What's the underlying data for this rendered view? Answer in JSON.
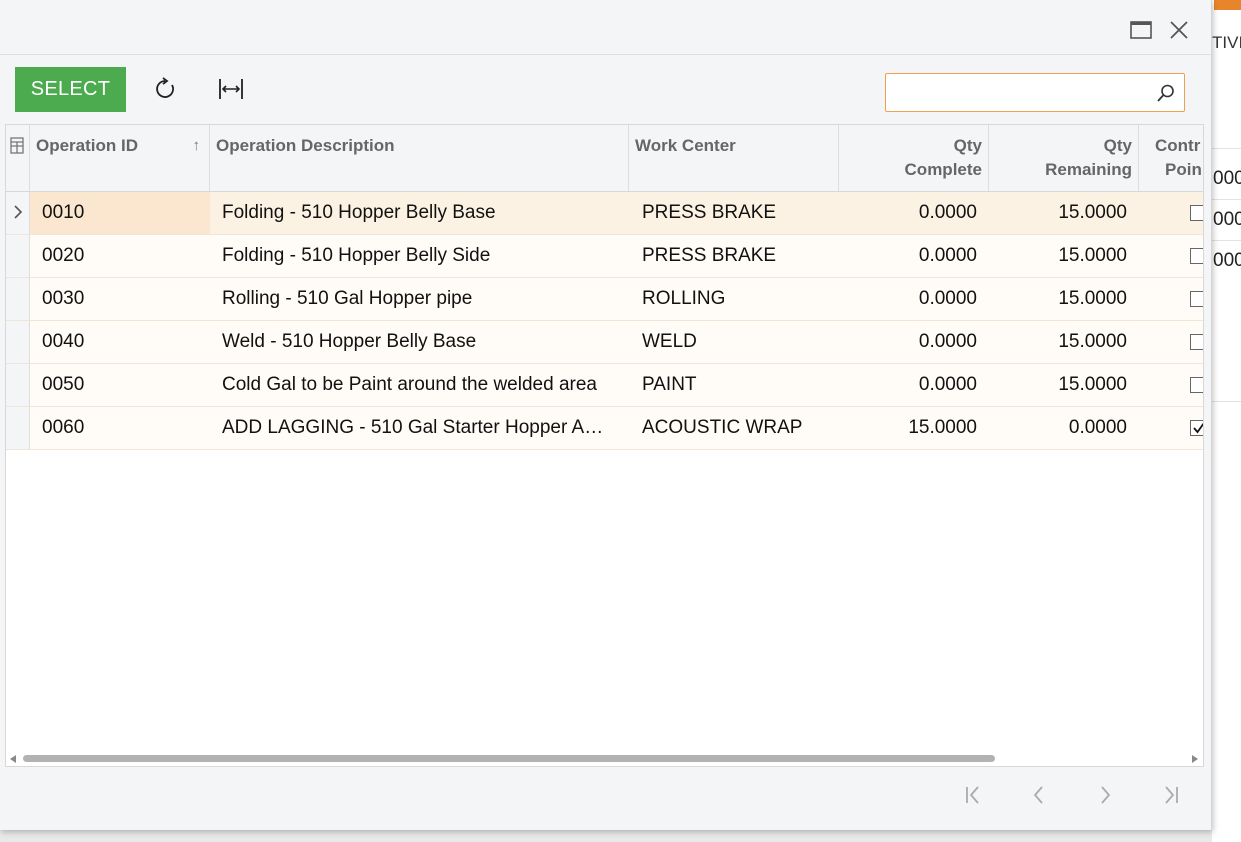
{
  "background": {
    "header_fragment": "TIVI",
    "cell_fragments": [
      "000",
      "000",
      "000"
    ],
    "accent_color": "#e8852c"
  },
  "dialog": {
    "window_controls": {
      "maximize": "maximize-icon",
      "close": "close-icon"
    },
    "toolbar": {
      "select_label": "SELECT",
      "refresh_icon": "refresh-icon",
      "fit_icon": "fit-to-screen-icon",
      "search_value": "",
      "search_placeholder": ""
    },
    "grid": {
      "columns": {
        "operation_id": "Operation ID",
        "operation_description": "Operation Description",
        "work_center": "Work Center",
        "qty_complete_line1": "Qty",
        "qty_complete_line2": "Complete",
        "qty_remaining_line1": "Qty",
        "qty_remaining_line2": "Remaining",
        "control_point_line1": "Contr",
        "control_point_line2": "Poin",
        "sort_indicator": "↑"
      },
      "rows": [
        {
          "operation_id": "0010",
          "description": "Folding - 510 Hopper Belly Base",
          "work_center": "PRESS BRAKE",
          "qty_complete": "0.0000",
          "qty_remaining": "15.0000",
          "control_point": false,
          "active": true
        },
        {
          "operation_id": "0020",
          "description": "Folding - 510 Hopper Belly Side",
          "work_center": "PRESS BRAKE",
          "qty_complete": "0.0000",
          "qty_remaining": "15.0000",
          "control_point": false
        },
        {
          "operation_id": "0030",
          "description": "Rolling - 510 Gal Hopper pipe",
          "work_center": "ROLLING",
          "qty_complete": "0.0000",
          "qty_remaining": "15.0000",
          "control_point": false
        },
        {
          "operation_id": "0040",
          "description": "Weld - 510 Hopper Belly Base",
          "work_center": "WELD",
          "qty_complete": "0.0000",
          "qty_remaining": "15.0000",
          "control_point": false
        },
        {
          "operation_id": "0050",
          "description": "Cold Gal to be Paint around the welded area",
          "work_center": "PAINT",
          "qty_complete": "0.0000",
          "qty_remaining": "15.0000",
          "control_point": false
        },
        {
          "operation_id": "0060",
          "description": "ADD LAGGING - 510 Gal Starter Hopper A…",
          "work_center": "ACOUSTIC WRAP",
          "qty_complete": "15.0000",
          "qty_remaining": "0.0000",
          "control_point": true
        }
      ]
    },
    "pager": {
      "first": "first-page-icon",
      "prev": "previous-page-icon",
      "next": "next-page-icon",
      "last": "last-page-icon"
    },
    "colors": {
      "select_button": "#4caa4f",
      "search_border": "#f0a050",
      "active_row": "#fcf2e4"
    }
  }
}
